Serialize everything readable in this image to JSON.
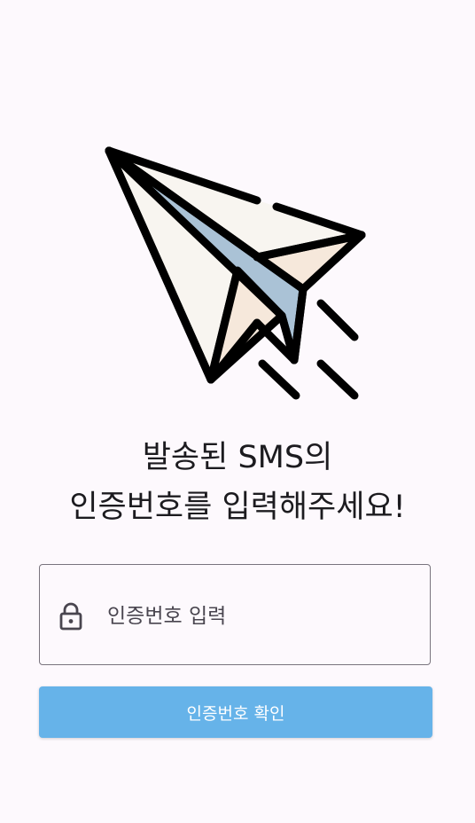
{
  "illustration": {
    "icon": "paper-plane-icon"
  },
  "headline": {
    "line1": "발송된 SMS의",
    "line2": "인증번호를 입력해주세요!"
  },
  "code_field": {
    "icon": "lock-icon",
    "placeholder": "인증번호 입력",
    "value": ""
  },
  "confirm_button": {
    "label": "인증번호 확인",
    "color": "#66b3e9"
  },
  "colors": {
    "background": "#fdf9fd",
    "plane_front": "#f8f5f0",
    "plane_fold": "#aac2d6",
    "plane_back": "#f6e8db"
  }
}
